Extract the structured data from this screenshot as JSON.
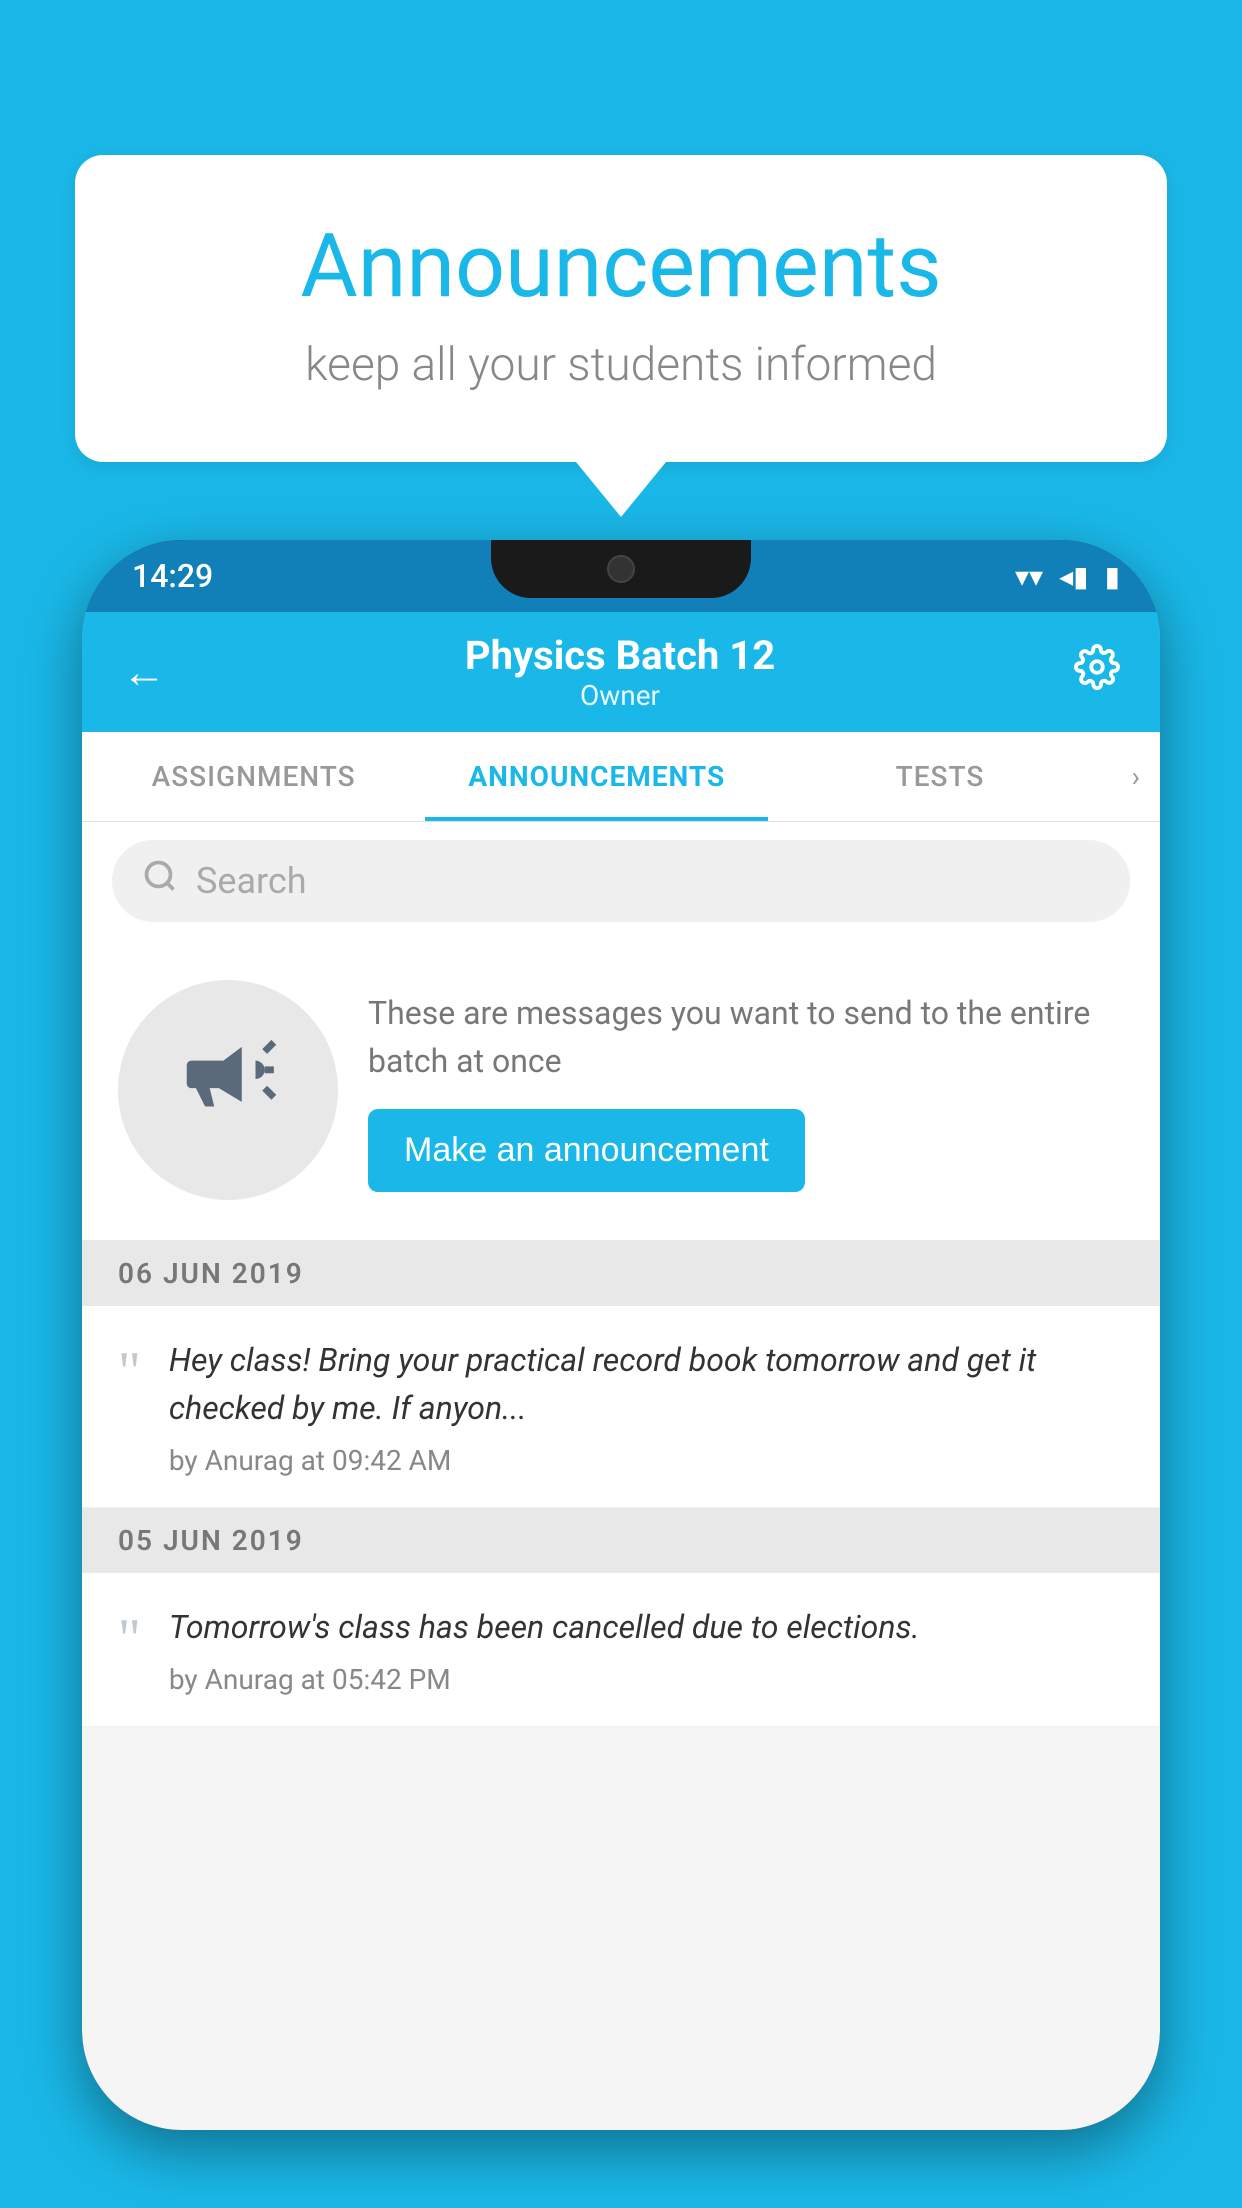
{
  "background_color": "#1ab8e8",
  "speech_bubble": {
    "title": "Announcements",
    "subtitle": "keep all your students informed"
  },
  "phone": {
    "status_bar": {
      "time": "14:29",
      "wifi": "▼",
      "signal": "◀",
      "battery": "▮"
    },
    "header": {
      "title": "Physics Batch 12",
      "subtitle": "Owner",
      "back_label": "←",
      "settings_label": "⚙"
    },
    "tabs": [
      {
        "label": "ASSIGNMENTS",
        "active": false
      },
      {
        "label": "ANNOUNCEMENTS",
        "active": true
      },
      {
        "label": "TESTS",
        "active": false
      }
    ],
    "search": {
      "placeholder": "Search"
    },
    "promo": {
      "description": "These are messages you want to send to the entire batch at once",
      "button_label": "Make an announcement"
    },
    "announcements": [
      {
        "date": "06  JUN  2019",
        "text": "Hey class! Bring your practical record book tomorrow and get it checked by me. If anyon...",
        "meta": "by Anurag at 09:42 AM"
      },
      {
        "date": "05  JUN  2019",
        "text": "Tomorrow's class has been cancelled due to elections.",
        "meta": "by Anurag at 05:42 PM"
      }
    ]
  }
}
